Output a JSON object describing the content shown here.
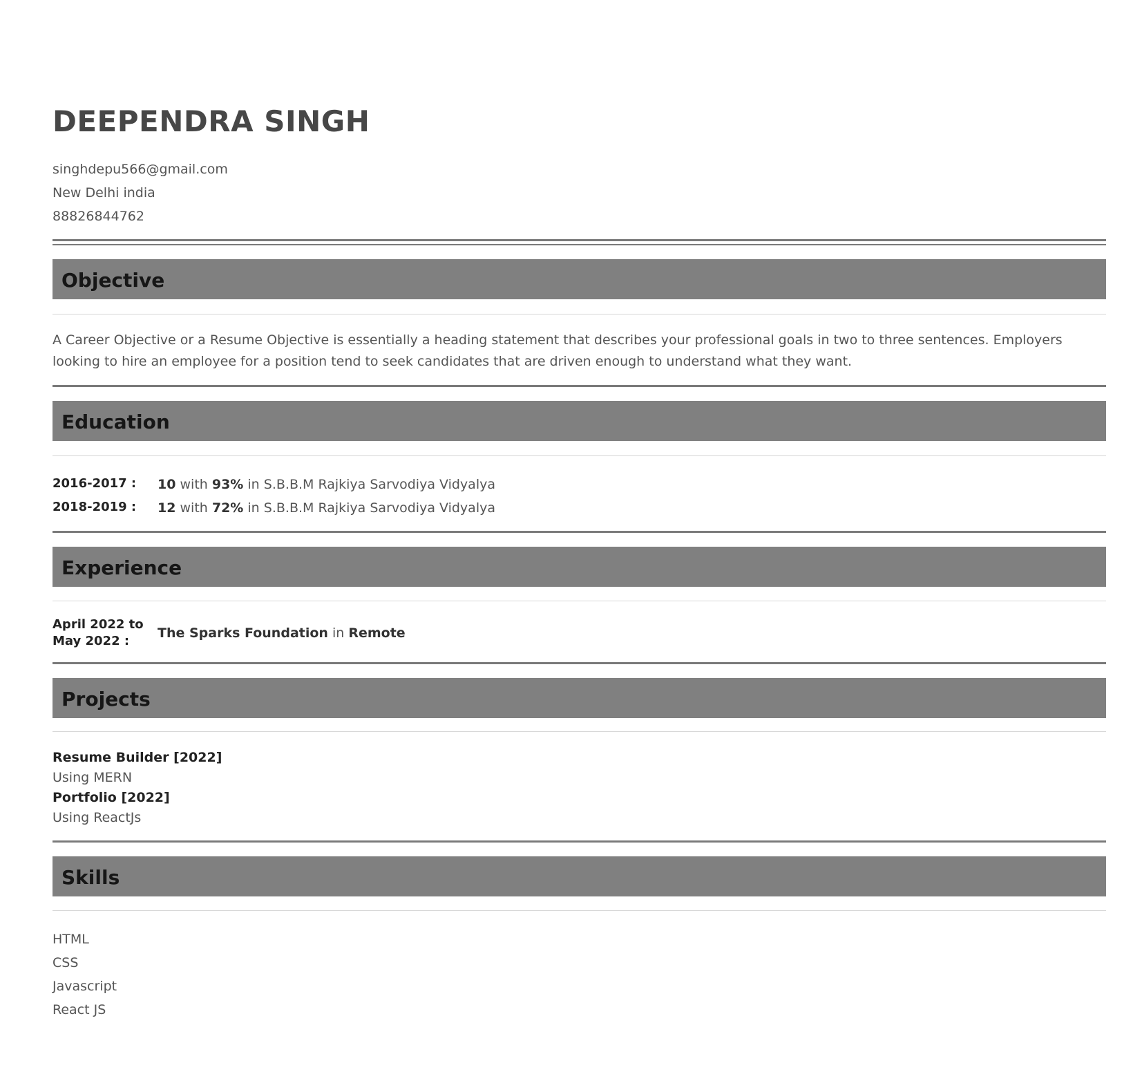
{
  "header": {
    "name": "DEEPENDRA SINGH",
    "email": "singhdepu566@gmail.com",
    "location": "New Delhi india",
    "phone": "88826844762"
  },
  "objective": {
    "heading": "Objective",
    "text": "A Career Objective or a Resume Objective is essentially a heading statement that describes your professional goals in two to three sentences. Employers looking to hire an employee for a position tend to seek candidates that are driven enough to understand what they want."
  },
  "education": {
    "heading": "Education",
    "items": [
      {
        "period": "2016-2017 :",
        "grade": "10",
        "with": "with",
        "percent": "93%",
        "in": "in",
        "school": "S.B.B.M Rajkiya Sarvodiya Vidyalya"
      },
      {
        "period": "2018-2019 :",
        "grade": "12",
        "with": "with",
        "percent": "72%",
        "in": "in",
        "school": "S.B.B.M Rajkiya Sarvodiya Vidyalya"
      }
    ]
  },
  "experience": {
    "heading": "Experience",
    "items": [
      {
        "period": "April 2022 to May 2022 :",
        "company": "The Sparks Foundation",
        "in": "in",
        "location": "Remote"
      }
    ]
  },
  "projects": {
    "heading": "Projects",
    "items": [
      {
        "title": "Resume Builder [2022]",
        "tech": "Using MERN"
      },
      {
        "title": "Portfolio [2022]",
        "tech": "Using ReactJs"
      }
    ]
  },
  "skills": {
    "heading": "Skills",
    "items": [
      "HTML",
      "CSS",
      "Javascript",
      "React JS"
    ]
  },
  "colors": {
    "section_header_bg": "#808080",
    "rule": "#7a7a7a",
    "text": "#555555",
    "heading_text": "#161616"
  }
}
